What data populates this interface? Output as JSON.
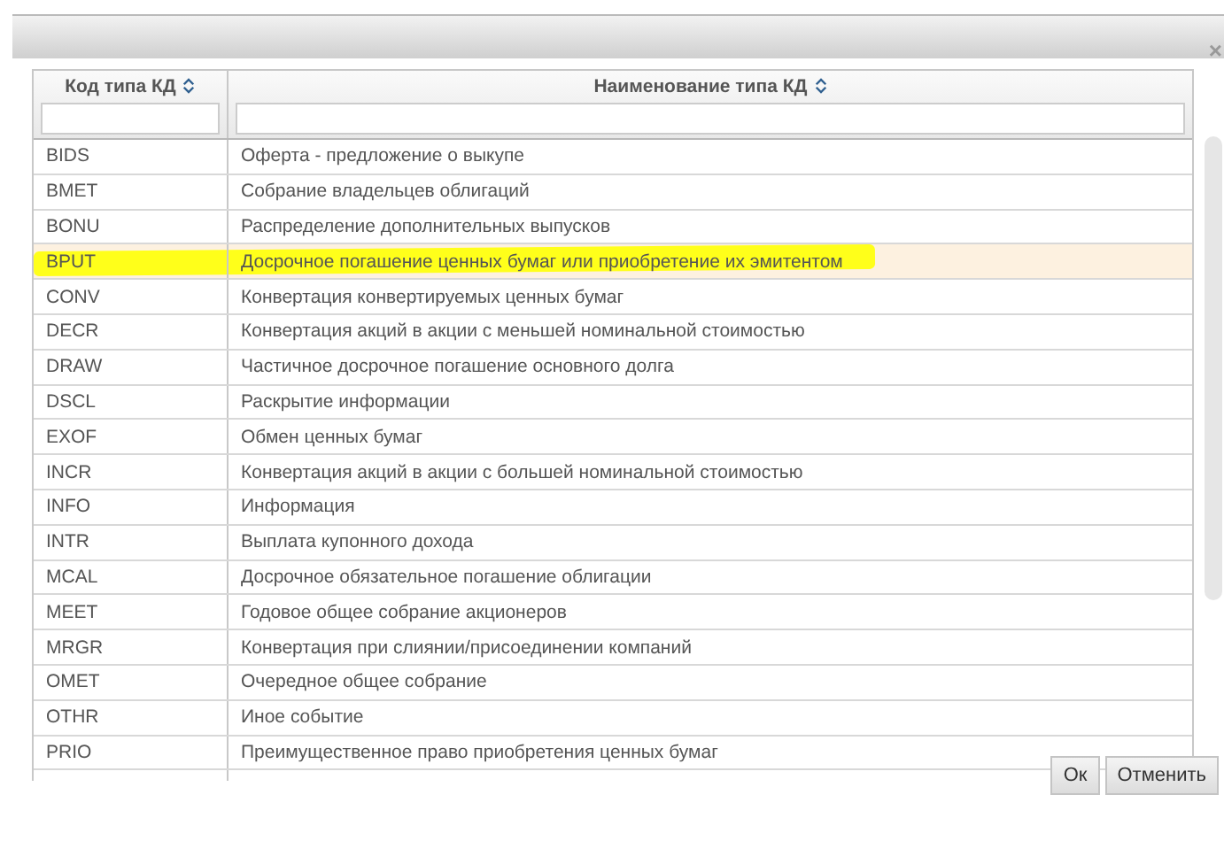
{
  "dialog": {
    "close": "×"
  },
  "table": {
    "columns": [
      {
        "label": "Код типа КД",
        "sortable": true
      },
      {
        "label": "Наименование типа КД",
        "sortable": true
      }
    ],
    "rows": [
      {
        "code": "BIDS",
        "name": "Оферта - предложение о выкупе",
        "selected": false,
        "highlighted": false
      },
      {
        "code": "BMET",
        "name": "Собрание владельцев облигаций",
        "selected": false,
        "highlighted": false
      },
      {
        "code": "BONU",
        "name": "Распределение дополнительных выпусков",
        "selected": false,
        "highlighted": false
      },
      {
        "code": "BPUT",
        "name": "Досрочное погашение ценных бумаг или приобретение их эмитентом",
        "selected": true,
        "highlighted": true
      },
      {
        "code": "CONV",
        "name": "Конвертация конвертируемых ценных бумаг",
        "selected": false,
        "highlighted": false
      },
      {
        "code": "DECR",
        "name": "Конвертация акций в акции с меньшей номинальной стоимостью",
        "selected": false,
        "highlighted": false
      },
      {
        "code": "DRAW",
        "name": "Частичное досрочное погашение основного долга",
        "selected": false,
        "highlighted": false
      },
      {
        "code": "DSCL",
        "name": "Раскрытие информации",
        "selected": false,
        "highlighted": false
      },
      {
        "code": "EXOF",
        "name": "Обмен ценных бумаг",
        "selected": false,
        "highlighted": false
      },
      {
        "code": "INCR",
        "name": "Конвертация акций в акции с большей номинальной стоимостью",
        "selected": false,
        "highlighted": false
      },
      {
        "code": "INFO",
        "name": "Информация",
        "selected": false,
        "highlighted": false
      },
      {
        "code": "INTR",
        "name": "Выплата купонного дохода",
        "selected": false,
        "highlighted": false
      },
      {
        "code": "MCAL",
        "name": "Досрочное обязательное погашение облигации",
        "selected": false,
        "highlighted": false
      },
      {
        "code": "MEET",
        "name": "Годовое общее собрание акционеров",
        "selected": false,
        "highlighted": false
      },
      {
        "code": "MRGR",
        "name": "Конвертация при слиянии/присоединении компаний",
        "selected": false,
        "highlighted": false
      },
      {
        "code": "OMET",
        "name": "Очередное общее собрание",
        "selected": false,
        "highlighted": false
      },
      {
        "code": "OTHR",
        "name": "Иное событие",
        "selected": false,
        "highlighted": false
      },
      {
        "code": "PRIO",
        "name": "Преимущественное право приобретения ценных бумаг",
        "selected": false,
        "highlighted": false
      }
    ]
  },
  "buttons": [
    "Ок",
    "Отменить"
  ]
}
